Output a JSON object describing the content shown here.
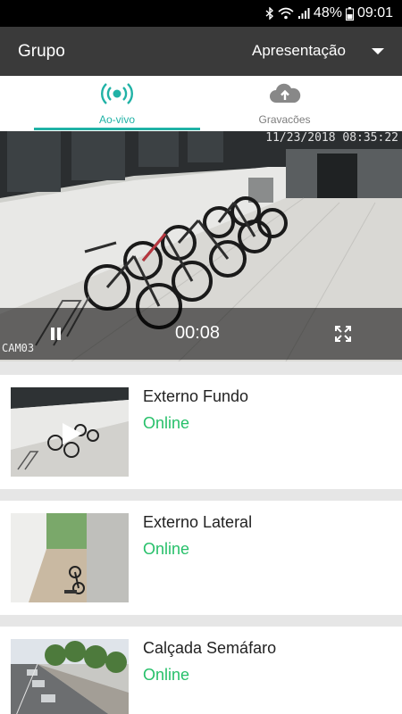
{
  "statusbar": {
    "battery": "48%",
    "time": "09:01"
  },
  "appbar": {
    "title": "Grupo",
    "selector": "Apresentação"
  },
  "tabs": [
    {
      "label": "Ao-vivo",
      "active": true,
      "icon": "live-broadcast-icon"
    },
    {
      "label": "Gravacões",
      "active": false,
      "icon": "cloud-upload-icon"
    }
  ],
  "player": {
    "timestamp": "11/23/2018 08:35:22",
    "camera_label": "CAM03",
    "elapsed": "00:08"
  },
  "cameras": [
    {
      "name": "Externo Fundo",
      "status": "Online"
    },
    {
      "name": "Externo Lateral",
      "status": "Online"
    },
    {
      "name": "Calçada Semáfaro",
      "status": "Online"
    }
  ],
  "colors": {
    "accent": "#20b2a6",
    "online": "#27c06a",
    "appbar": "#3a3a3a"
  }
}
